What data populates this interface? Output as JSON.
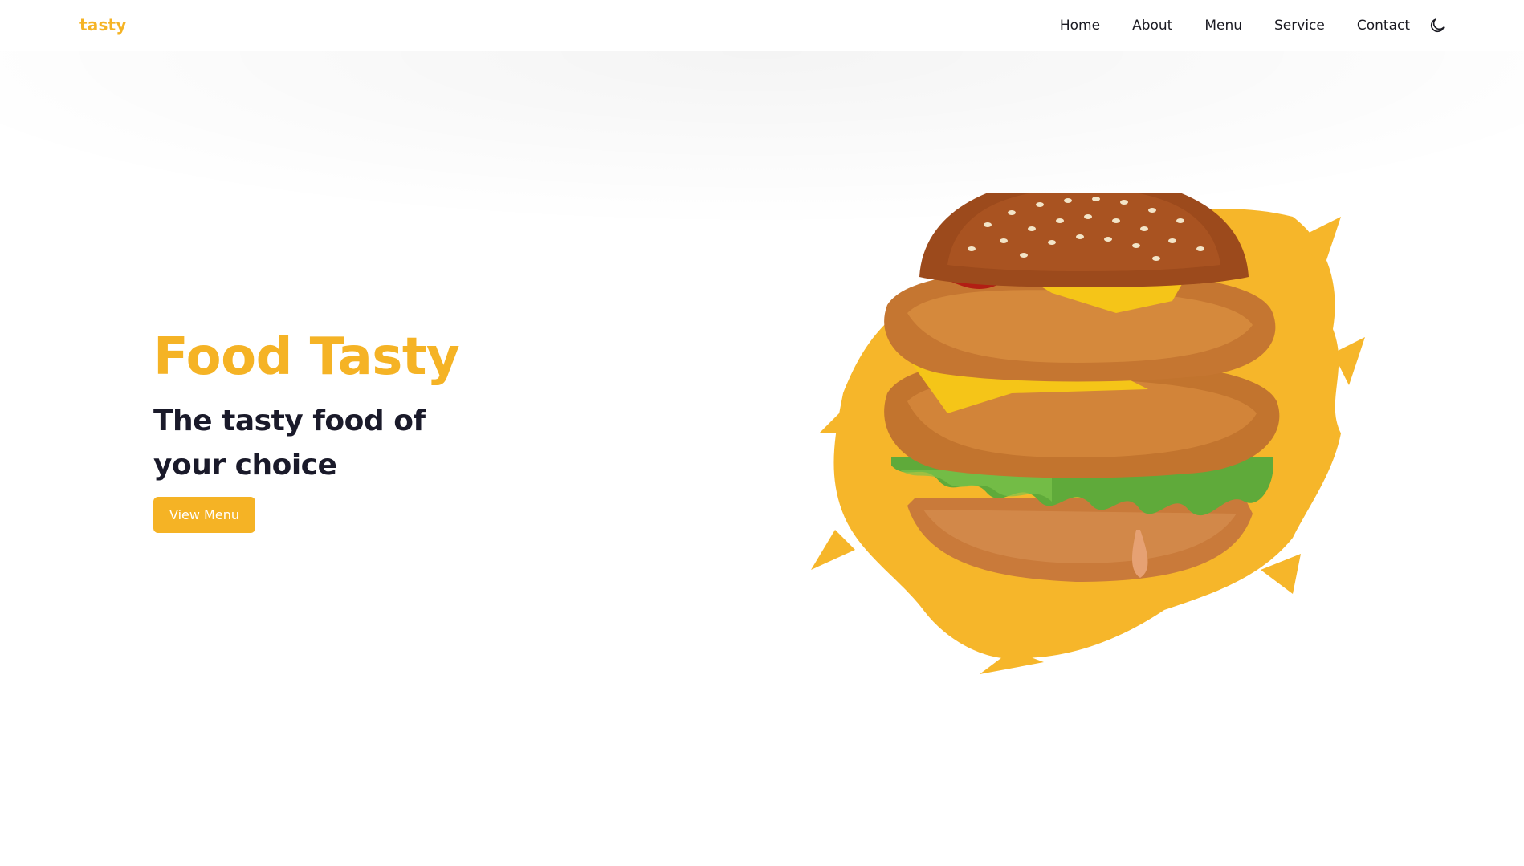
{
  "brand": {
    "logo": "tasty",
    "accent_color": "#f5b325",
    "text_color": "#1a1a2a"
  },
  "nav": {
    "items": [
      {
        "label": "Home"
      },
      {
        "label": "About"
      },
      {
        "label": "Menu"
      },
      {
        "label": "Service"
      },
      {
        "label": "Contact"
      }
    ],
    "theme_toggle_icon": "moon-icon"
  },
  "hero": {
    "title": "Food Tasty",
    "subtitle": "The tasty food of your choice",
    "cta_label": "View Menu",
    "image_icon": "burger-illustration"
  }
}
